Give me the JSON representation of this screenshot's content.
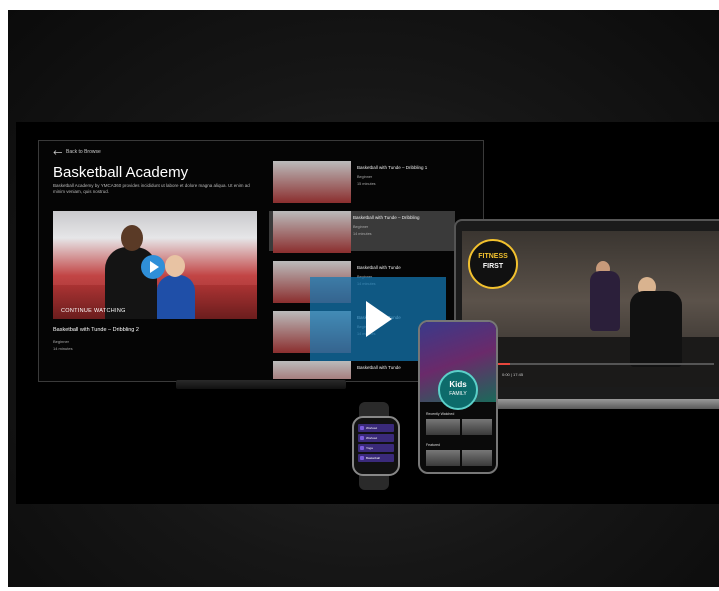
{
  "tv": {
    "back_label": "Back to Browse",
    "title": "Basketball Academy",
    "description": "Basketball Academy by YMCA360 provides incididunt ut labore et dolore magna aliqua. Ut enim ad minim veniam, quis nostrud.",
    "continue_label": "CONTINUE WATCHING",
    "hero_video": {
      "title": "Basketball with Tunde – Dribbling 2",
      "level": "Beginner",
      "duration": "14 minutes"
    },
    "list": [
      {
        "title": "Basketball with Tunde – Dribbling 1",
        "level": "Beginner",
        "duration": "15 minutes"
      },
      {
        "title": "Basketball with Tunde – Dribbling",
        "level": "Beginner",
        "duration": "14 minutes"
      },
      {
        "title": "Basketball with Tunde",
        "level": "Beginner",
        "duration": "14 minutes"
      },
      {
        "title": "Basketball with Tunde",
        "level": "Beginner",
        "duration": "14 minutes"
      },
      {
        "title": "Basketball with Tunde",
        "level": "",
        "duration": ""
      }
    ]
  },
  "laptop": {
    "logo_top": "FITNESS",
    "logo_bottom": "FIRST",
    "time": "0:00 | 17:45",
    "progress": 0.15
  },
  "phone": {
    "badge_title": "Kids",
    "badge_sub": "FAMILY",
    "section1": "Recently Watched",
    "section2": "Featured"
  },
  "watch": {
    "items": [
      "Workout",
      "Workout",
      "Yoga",
      "Basketball"
    ]
  },
  "icons": {
    "play": "play-icon",
    "back": "back-arrow-icon"
  },
  "colors": {
    "overlay": "#1478b4",
    "accent": "#2f8fd8",
    "logo": "#f2c12e"
  }
}
